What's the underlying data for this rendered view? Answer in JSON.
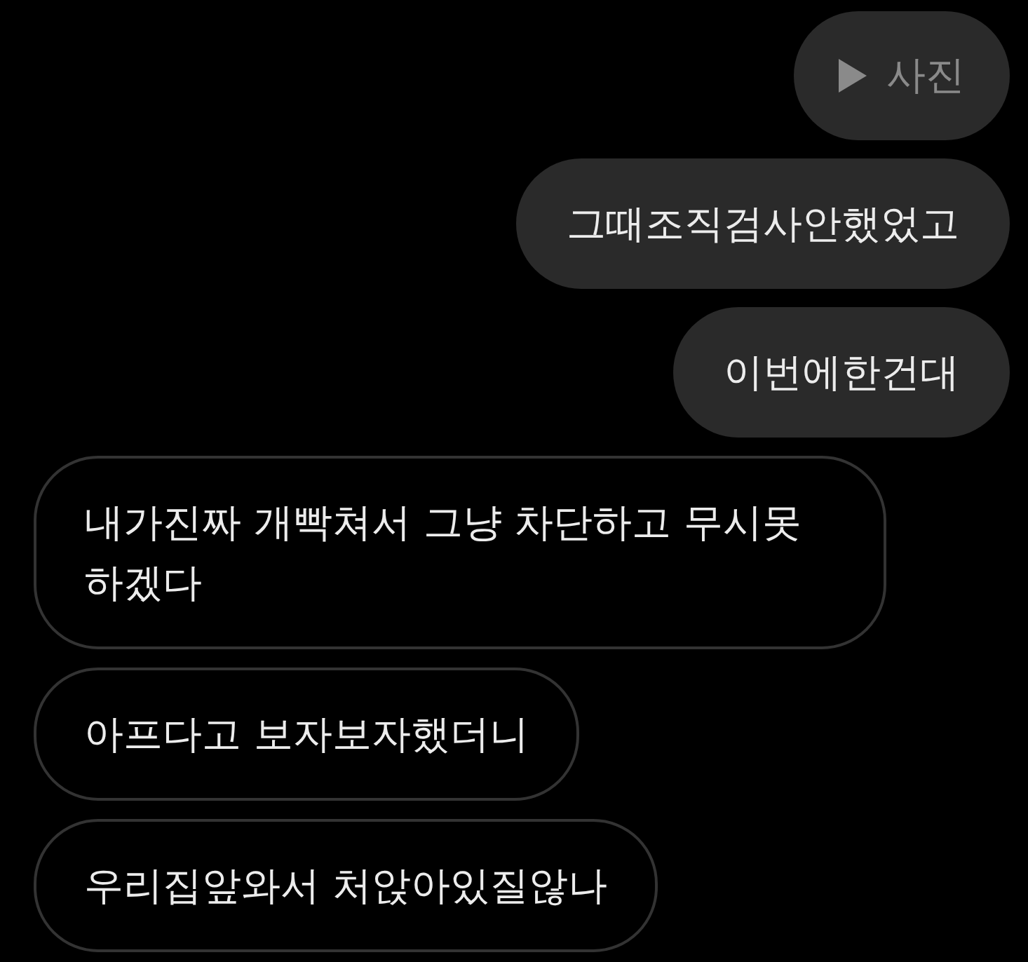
{
  "messages": [
    {
      "kind": "photo",
      "outgoing": true,
      "text": "사진"
    },
    {
      "kind": "text",
      "outgoing": true,
      "text": "그때조직검사안했었고"
    },
    {
      "kind": "text",
      "outgoing": true,
      "text": "이번에한건대"
    },
    {
      "kind": "text",
      "outgoing": false,
      "text": "내가진짜 개빡쳐서 그냥 차단하고 무시못하겠다"
    },
    {
      "kind": "text",
      "outgoing": false,
      "text": "아프다고 보자보자했더니"
    },
    {
      "kind": "text",
      "outgoing": false,
      "text": "우리집앞와서 처앉아있질않나"
    }
  ]
}
